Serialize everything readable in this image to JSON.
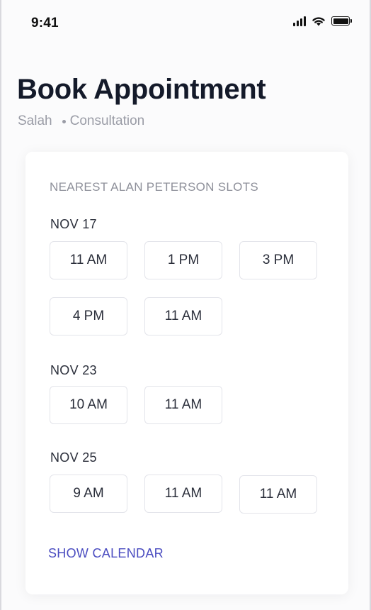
{
  "status_bar": {
    "time": "9:41",
    "icons": [
      "signal-icon",
      "wifi-icon",
      "battery-icon"
    ]
  },
  "header": {
    "title": "Book Appointment",
    "provider": "Salah",
    "service": "Consultation"
  },
  "slots_card": {
    "heading": "NEAREST ALAN PETERSON SLOTS",
    "days": [
      {
        "label": "NOV 17",
        "slots": [
          "11 AM",
          "1 PM",
          "3 PM",
          "4 PM",
          "11 AM"
        ]
      },
      {
        "label": "NOV 23",
        "slots": [
          "10 AM",
          "11 AM"
        ]
      },
      {
        "label": "NOV 25",
        "slots": [
          "9 AM",
          "11 AM",
          "11 AM"
        ]
      }
    ],
    "show_calendar_label": "SHOW CALENDAR"
  },
  "colors": {
    "title": "#141a2a",
    "muted": "#9a9ca6",
    "link": "#4a4cc0",
    "slot_border": "#e3e4ea"
  }
}
